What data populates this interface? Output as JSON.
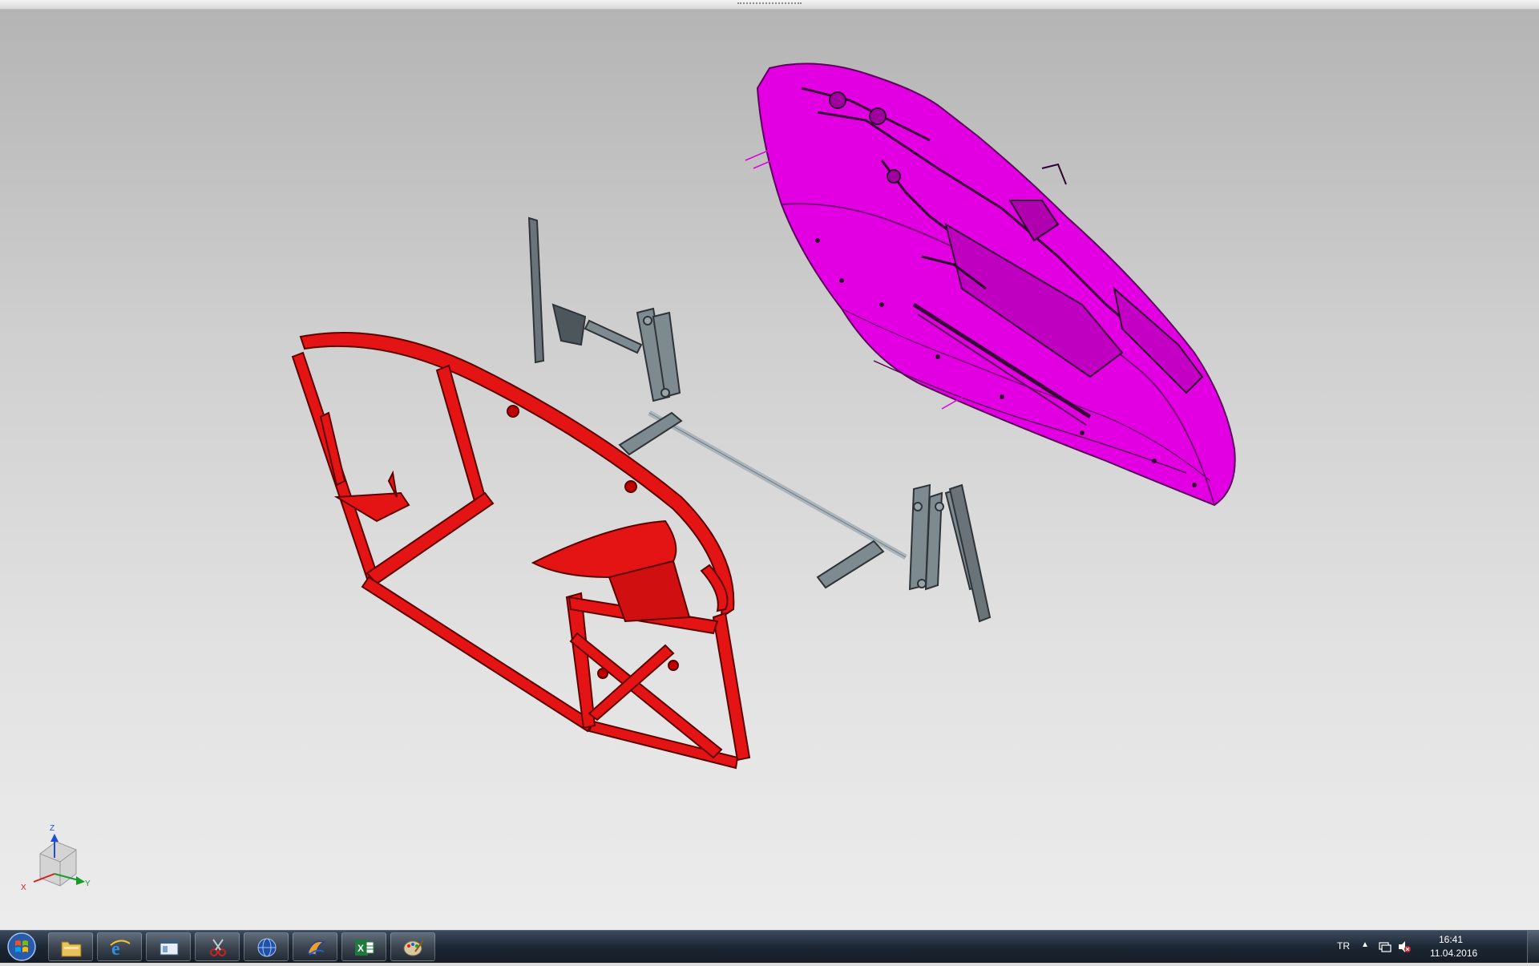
{
  "window": {
    "resize_grip": "resize-grip"
  },
  "viewport": {
    "parts": [
      {
        "name": "magenta-body-shell",
        "color": "#e000e0"
      },
      {
        "name": "red-chassis-frame",
        "color": "#e01010"
      },
      {
        "name": "grey-steering-assembly",
        "color": "#7d8a8f"
      }
    ],
    "axis_triad": {
      "z_label": "Z",
      "x_label": "X",
      "y_label": "Y",
      "z_color": "#1f4fd0",
      "x_color": "#d02020",
      "y_color": "#1a9a2a"
    }
  },
  "taskbar": {
    "buttons": [
      {
        "name": "file-explorer-taskbar-button",
        "icon": "folder-icon"
      },
      {
        "name": "internet-explorer-taskbar-button",
        "icon": "ie-icon"
      },
      {
        "name": "window-app-taskbar-button",
        "icon": "window-icon"
      },
      {
        "name": "snipping-tool-taskbar-button",
        "icon": "scissors-icon"
      },
      {
        "name": "globe-app-taskbar-button",
        "icon": "globe-icon"
      },
      {
        "name": "cad-app-taskbar-button",
        "icon": "cad-icon"
      },
      {
        "name": "excel-taskbar-button",
        "icon": "excel-icon"
      },
      {
        "name": "paint-taskbar-button",
        "icon": "paint-icon"
      }
    ],
    "tray": {
      "language": "TR",
      "time": "16:41",
      "date": "11.04.2016"
    }
  }
}
